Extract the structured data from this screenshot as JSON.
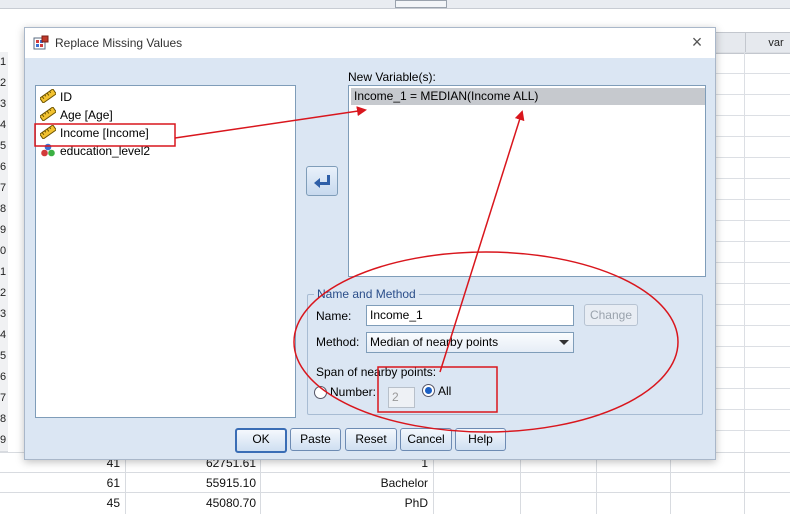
{
  "window": {
    "title": "Replace Missing Values",
    "close_glyph": "×"
  },
  "source_variables": [
    {
      "label": "ID",
      "icon": "ruler-scale-icon"
    },
    {
      "label": "Age [Age]",
      "icon": "ruler-scale-icon"
    },
    {
      "label": "Income [Income]",
      "icon": "ruler-scale-icon"
    },
    {
      "label": "education_level2",
      "icon": "nominal-circles-icon"
    }
  ],
  "new_variables": {
    "label": "New Variable(s):",
    "items": [
      "Income_1 = MEDIAN(Income ALL)"
    ]
  },
  "name_and_method": {
    "legend": "Name and Method",
    "name_label": "Name:",
    "name_value": "Income_1",
    "change_label": "Change",
    "method_label": "Method:",
    "method_value": "Median of nearby points",
    "span_label": "Span of nearby points:",
    "number_label": "Number:",
    "number_value": "2",
    "all_label": "All"
  },
  "buttons": {
    "ok": "OK",
    "paste": "Paste",
    "reset": "Reset",
    "cancel": "Cancel",
    "help": "Help"
  },
  "background_sheet": {
    "column_header_right": "var",
    "row_numbers": [
      "1",
      "2",
      "3",
      "4",
      "5",
      "6",
      "7",
      "8",
      "9",
      "0",
      "1",
      "2",
      "3",
      "4",
      "5",
      "6",
      "7",
      "8",
      "9"
    ],
    "bottom_rows": [
      {
        "col1": "41",
        "col2": "62751.61",
        "col3": "1"
      },
      {
        "col1": "61",
        "col2": "55915.10",
        "col3": "Bachelor"
      },
      {
        "col1": "45",
        "col2": "45080.70",
        "col3": "PhD"
      }
    ]
  },
  "annotation_color": "#d9161d"
}
